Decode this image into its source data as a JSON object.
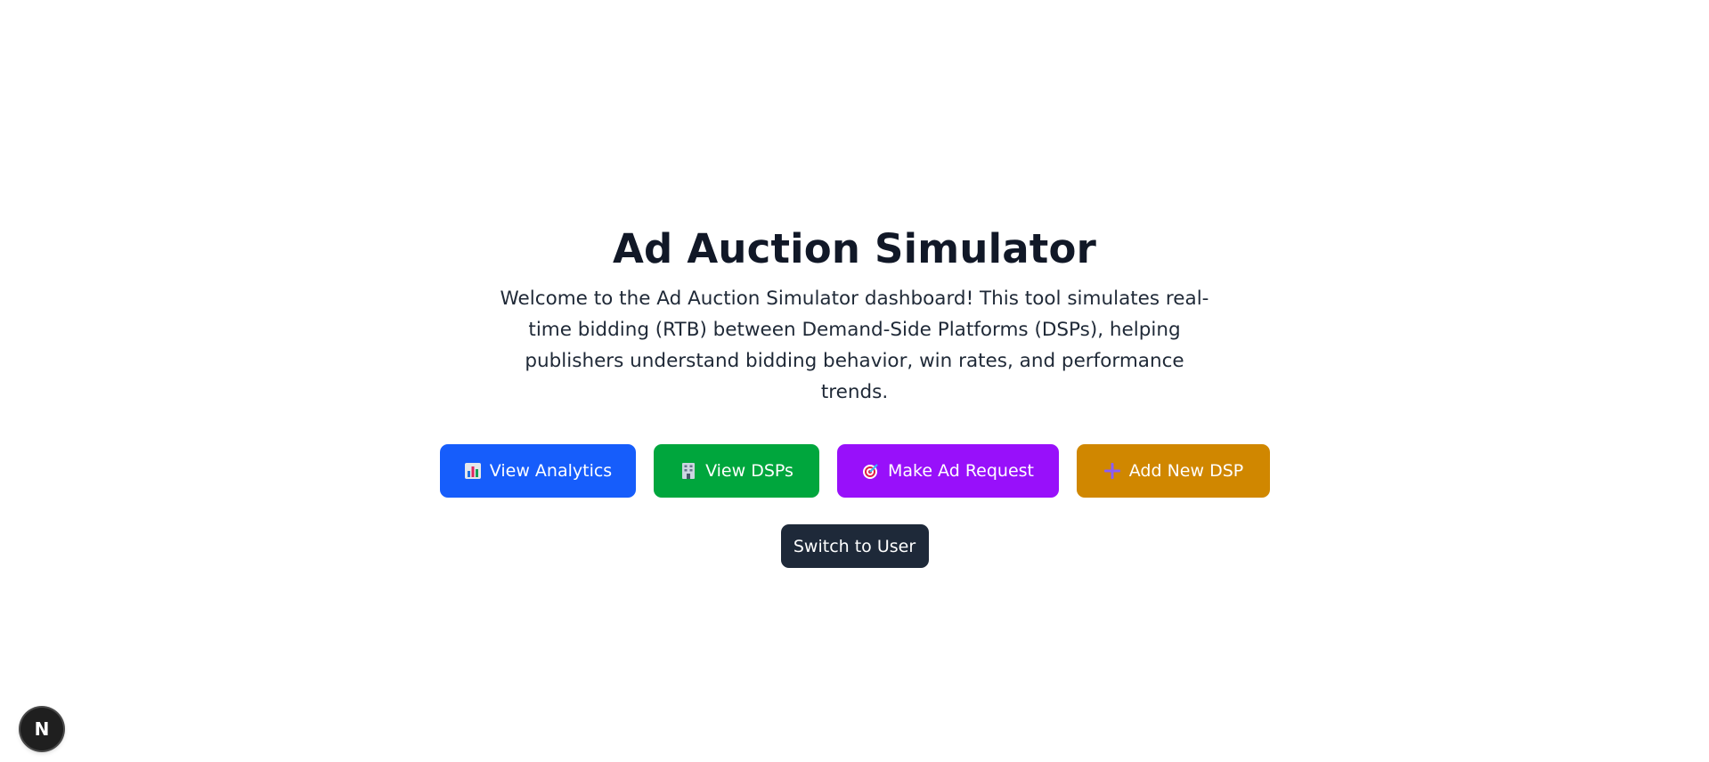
{
  "hero": {
    "title": "Ad Auction Simulator",
    "description": "Welcome to the Ad Auction Simulator dashboard! This tool simulates real-time bidding (RTB) between Demand-Side Platforms (DSPs), helping publishers understand bidding behavior, win rates, and performance trends."
  },
  "actions": [
    {
      "label": "View Analytics",
      "icon": "bar-chart-icon",
      "color": "#165dfb"
    },
    {
      "label": "View DSPs",
      "icon": "office-building-icon",
      "color": "#00a63d"
    },
    {
      "label": "Make Ad Request",
      "icon": "target-icon",
      "color": "#9810fa"
    },
    {
      "label": "Add New DSP",
      "icon": "plus-icon",
      "color": "#d08700"
    }
  ],
  "switch": {
    "label": "Switch to User",
    "color": "#1e2939"
  },
  "dev_badge": {
    "letter": "N",
    "icon": "nextjs-logo-icon"
  }
}
